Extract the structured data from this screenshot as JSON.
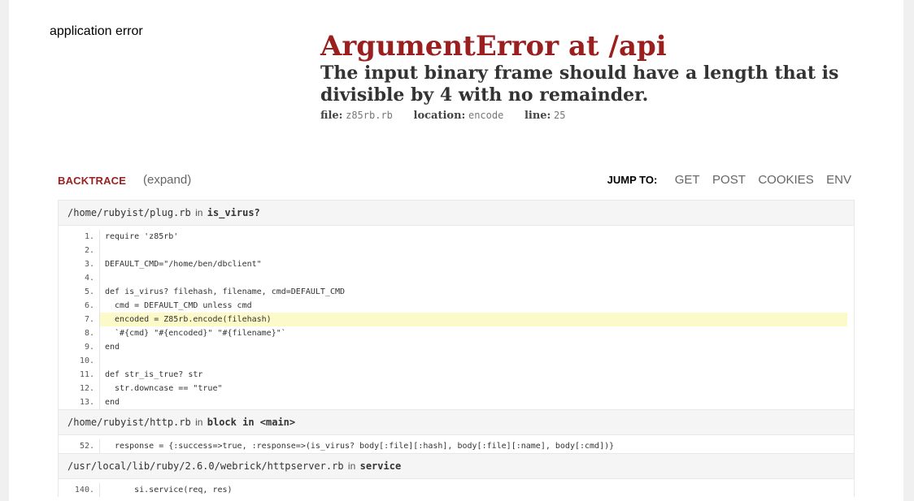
{
  "app_label": "application error",
  "error": {
    "title": "ArgumentError at /api",
    "message": "The input binary frame should have a length that is divisible by 4 with no remainder.",
    "file_key": "file:",
    "file_val": "z85rb.rb",
    "location_key": "location:",
    "location_val": "encode",
    "line_key": "line:",
    "line_val": "25"
  },
  "backtrace": {
    "label": "BACKTRACE",
    "expand": "(expand)"
  },
  "jump": {
    "label": "JUMP TO:",
    "links": [
      "GET",
      "POST",
      "COOKIES",
      "ENV"
    ]
  },
  "frames": [
    {
      "path": "/home/rubyist/plug.rb",
      "in": "in",
      "method": "is_virus?",
      "lines": [
        {
          "n": "1.",
          "code": "require 'z85rb'"
        },
        {
          "n": "2.",
          "code": ""
        },
        {
          "n": "3.",
          "code": "DEFAULT_CMD=\"/home/ben/dbclient\""
        },
        {
          "n": "4.",
          "code": ""
        },
        {
          "n": "5.",
          "code": "def is_virus? filehash, filename, cmd=DEFAULT_CMD"
        },
        {
          "n": "6.",
          "code": "  cmd = DEFAULT_CMD unless cmd"
        },
        {
          "n": "7.",
          "code": "  encoded = Z85rb.encode(filehash)"
        },
        {
          "n": "8.",
          "code": "  `#{cmd} \"#{encoded}\" \"#{filename}\"`"
        },
        {
          "n": "9.",
          "code": "end"
        },
        {
          "n": "10.",
          "code": ""
        },
        {
          "n": "11.",
          "code": "def str_is_true? str"
        },
        {
          "n": "12.",
          "code": "  str.downcase == \"true\""
        },
        {
          "n": "13.",
          "code": "end"
        }
      ]
    },
    {
      "path": "/home/rubyist/http.rb",
      "in": "in",
      "method": "block in <main>",
      "lines": [
        {
          "n": "52.",
          "code": "  response = {:success=>true, :response=>(is_virus? body[:file][:hash], body[:file][:name], body[:cmd])}"
        }
      ]
    },
    {
      "path": "/usr/local/lib/ruby/2.6.0/webrick/httpserver.rb",
      "in": "in",
      "method": "service",
      "lines": [
        {
          "n": "140.",
          "code": "      si.service(req, res)"
        }
      ]
    }
  ]
}
